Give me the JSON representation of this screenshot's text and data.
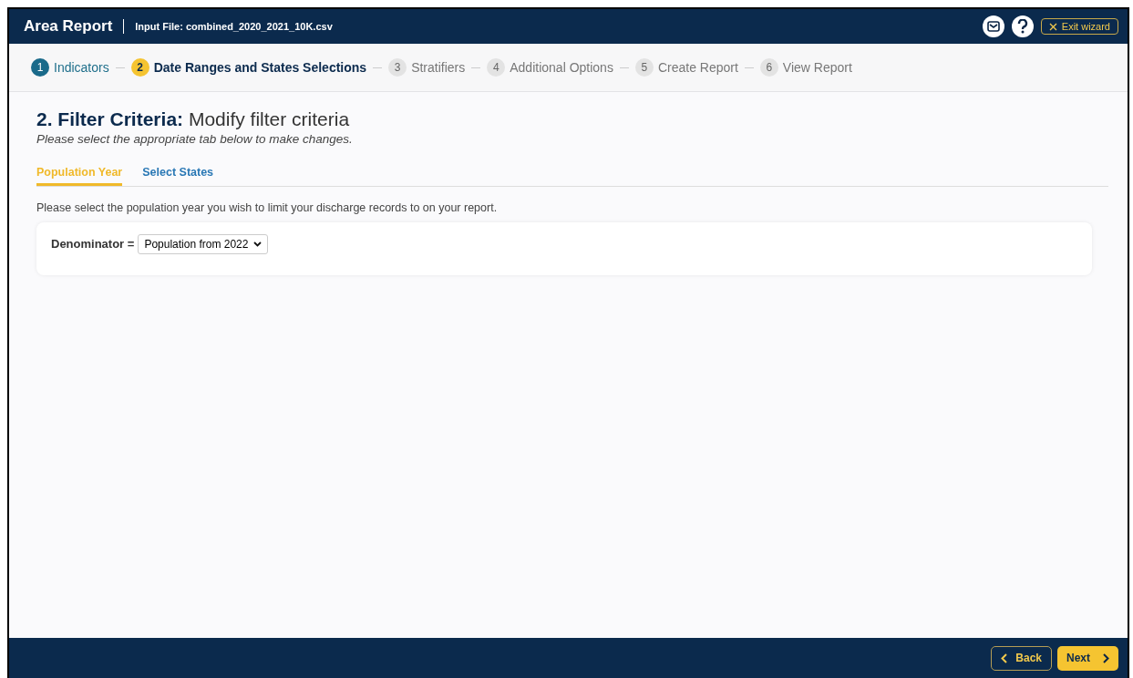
{
  "header": {
    "title": "Area Report",
    "input_file": "Input File: combined_2020_2021_10K.csv",
    "exit_label": "Exit wizard"
  },
  "steps": [
    {
      "number": "1",
      "label": "Indicators",
      "completed": true,
      "selected": false
    },
    {
      "number": "2",
      "label": "Date Ranges and States Selections",
      "completed": false,
      "selected": true
    },
    {
      "number": "3",
      "label": "Stratifiers",
      "completed": false,
      "selected": false
    },
    {
      "number": "4",
      "label": "Additional Options",
      "completed": false,
      "selected": false
    },
    {
      "number": "5",
      "label": "Create Report",
      "completed": false,
      "selected": false
    },
    {
      "number": "6",
      "label": "View Report",
      "completed": false,
      "selected": false
    }
  ],
  "heading": {
    "prefix": "2. Filter Criteria:",
    "title": "Modify filter criteria",
    "subtitle": "Please select the appropriate tab below to make changes."
  },
  "tabs": [
    {
      "label": "Population Year",
      "selected": true
    },
    {
      "label": "Select States",
      "selected": false
    }
  ],
  "instruction": "Please select the population year you wish to limit your discharge records to on your report.",
  "denominator": {
    "label": "Denominator =",
    "value": "Population from 2022"
  },
  "footer": {
    "back": "Back",
    "next": "Next"
  }
}
